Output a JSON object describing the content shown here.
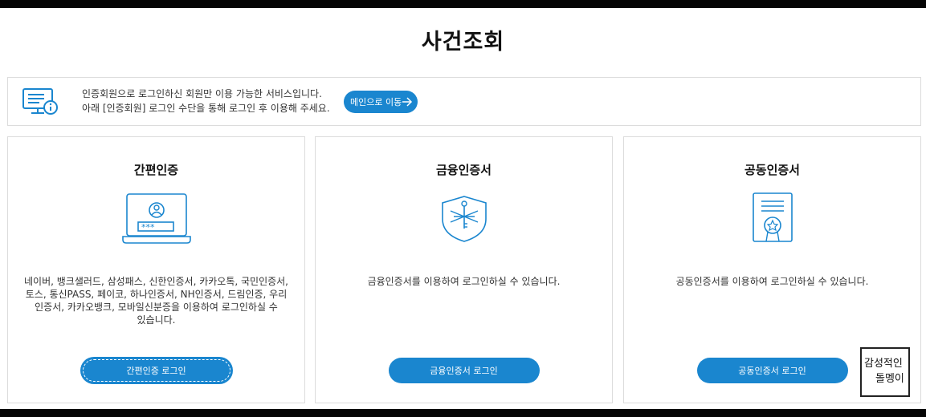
{
  "page_title": "사건조회",
  "notice": {
    "line1": "인증회원으로 로그인하신 회원만 이용 가능한 서비스입니다.",
    "line2": "아래 [인증회원] 로그인 수단을 통해 로그인 후 이용해 주세요.",
    "main_button": "메인으로 이동"
  },
  "cards": [
    {
      "title": "간편인증",
      "desc_lines": [
        "네이버, 뱅크샐러드, 삼성패스, 신한인증서, 카카오톡, 국민인증서,",
        "토스, 통신PASS, 페이코, 하나인증서, NH인증서, 드림인증, 우리",
        "인증서, 카카오뱅크, 모바일신분증을 이용하여 로그인하실 수",
        "있습니다."
      ],
      "button": "간편인증 로그인"
    },
    {
      "title": "금융인증서",
      "desc_lines": [
        "금융인증서를 이용하여 로그인하실 수 있습니다."
      ],
      "button": "금융인증서 로그인"
    },
    {
      "title": "공동인증서",
      "desc_lines": [
        "공동인증서를 이용하여 로그인하실 수 있습니다."
      ],
      "button": "공동인증서 로그인"
    }
  ],
  "watermark": {
    "line1": "감성적인",
    "line2": "돌멩이"
  },
  "colors": {
    "accent": "#1a86cf",
    "border": "#dcdcdc",
    "bar": "#050505"
  }
}
